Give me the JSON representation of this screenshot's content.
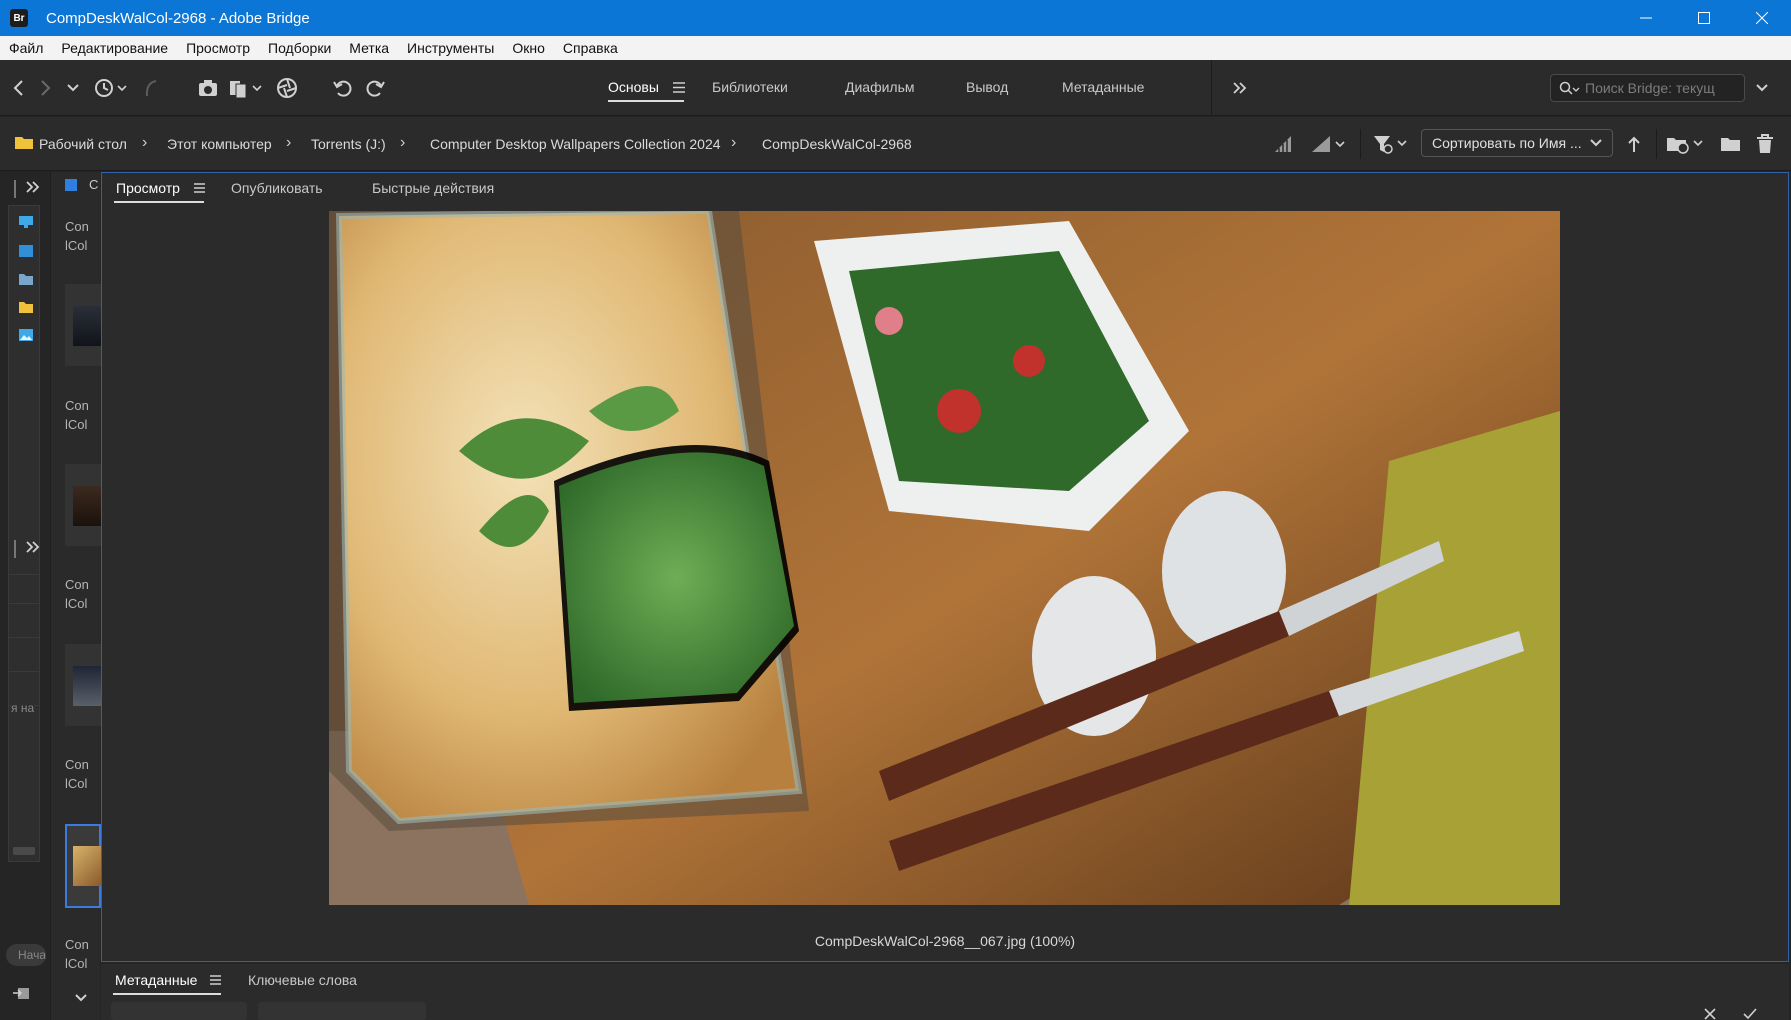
{
  "window": {
    "title": "CompDeskWalCol-2968 - Adobe Bridge",
    "app_badge": "Br"
  },
  "menu": [
    "Файл",
    "Редактирование",
    "Просмотр",
    "Подборки",
    "Метка",
    "Инструменты",
    "Окно",
    "Справка"
  ],
  "workspaces": {
    "tabs": [
      "Основы",
      "Библиотеки",
      "Диафильм",
      "Вывод",
      "Метаданные"
    ],
    "active": "Основы"
  },
  "search": {
    "placeholder": "Поиск Bridge: текущ"
  },
  "breadcrumbs": [
    "Рабочий стол",
    "Этот компьютер",
    "Torrents (J:)",
    "Computer Desktop Wallpapers Collection 2024",
    "CompDeskWalCol-2968"
  ],
  "sort": {
    "label": "Сортировать по Имя ..."
  },
  "preview_tabs": [
    "Просмотр",
    "Опубликовать",
    "Быстрые действия"
  ],
  "preview": {
    "caption": "CompDeskWalCol-2968__067.jpg (100%)"
  },
  "bottom_tabs": [
    "Метаданные",
    "Ключевые слова"
  ],
  "left_panel": {
    "partial_text": "я на",
    "start_button": "Нача"
  },
  "content_labels": [
    [
      "Con",
      "lCol"
    ],
    [
      "Con",
      "lCol"
    ],
    [
      "Con",
      "lCol"
    ],
    [
      "Con",
      "lCol"
    ],
    [
      "Con",
      "lCol"
    ]
  ],
  "colors": {
    "accent": "#0b76d6",
    "selection": "#2f62a8",
    "panel": "#2b2b2b"
  }
}
